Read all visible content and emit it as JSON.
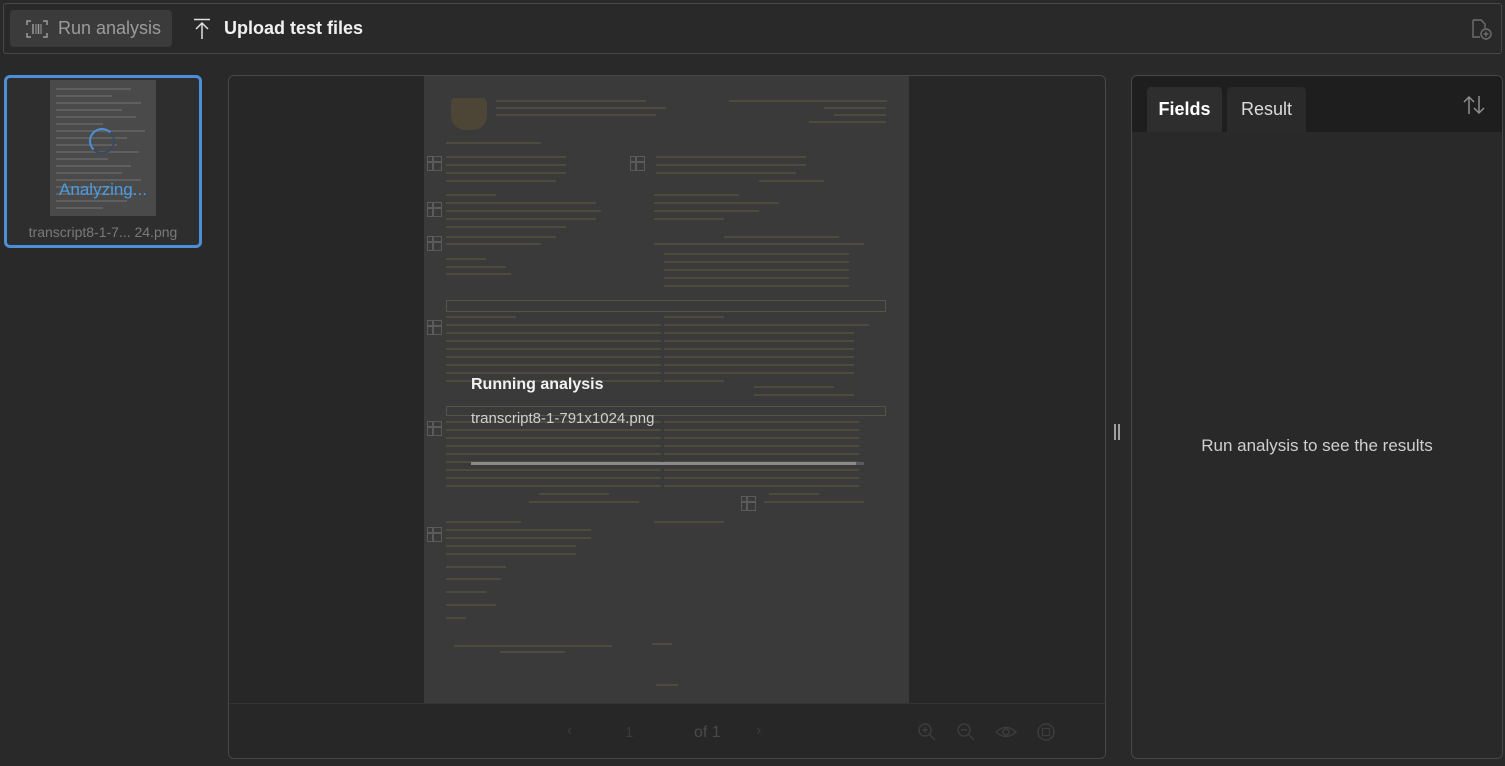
{
  "toolbar": {
    "run_label": "Run analysis",
    "upload_label": "Upload test files",
    "icons": {
      "run": "scan-barcode-icon",
      "upload": "arrow-upload-icon",
      "right": "document-add-icon"
    }
  },
  "files": [
    {
      "name": "transcript8-1-7... 24.png",
      "status": "Analyzing..."
    }
  ],
  "viewer": {
    "overlay_title": "Running analysis",
    "overlay_file": "transcript8-1-791x1024.png",
    "progress": 0.98,
    "pager": {
      "page": "1",
      "of_label": "of 1"
    }
  },
  "side_panel": {
    "tabs": [
      "Fields",
      "Result"
    ],
    "active_tab": "Fields",
    "empty_message": "Run analysis to see the results"
  },
  "colors": {
    "accent": "#4a8fd8",
    "background": "#292929",
    "panel_header": "#1e1e1e"
  }
}
